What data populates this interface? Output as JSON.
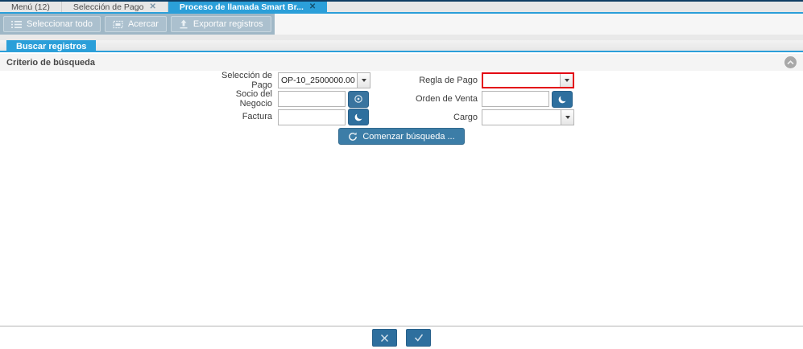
{
  "tabbar": {
    "close_glyph": "✕",
    "tabs": [
      {
        "label": "Menú (12)",
        "closable": false,
        "active": false
      },
      {
        "label": "Selección de Pago",
        "closable": true,
        "active": false
      },
      {
        "label": "Proceso de llamada Smart Br...",
        "closable": true,
        "active": true
      }
    ]
  },
  "toolbar": {
    "buttons": [
      {
        "label": "Seleccionar todo",
        "icon": "select-all-list-icon"
      },
      {
        "label": "Acercar",
        "icon": "zoom-window-icon"
      },
      {
        "label": "Exportar registros",
        "icon": "export-records-icon"
      }
    ]
  },
  "panel": {
    "find_tab": "Buscar registros",
    "section_title": "Criterio de búsqueda"
  },
  "form": {
    "fields": [
      {
        "label": "Selección de Pago",
        "type": "combobox",
        "value": "OP-10_2500000.00"
      },
      {
        "label": "Regla de Pago",
        "type": "combobox",
        "value": "",
        "highlight": "error-red"
      },
      {
        "label": "Socio del Negocio",
        "type": "lookup",
        "value": "",
        "icon": "business-partner-icon"
      },
      {
        "label": "Orden de Venta",
        "type": "lookup",
        "value": "",
        "icon": "record-search-icon"
      },
      {
        "label": "Factura",
        "type": "lookup",
        "value": "",
        "icon": "record-search-icon"
      },
      {
        "label": "Cargo",
        "type": "combobox",
        "value": ""
      }
    ],
    "search_button": "Comenzar búsqueda ..."
  },
  "colors": {
    "accent_blue": "#2b9fd9",
    "button_blue": "#2e6f9e",
    "toolbar_steel": "#9fb7c6",
    "error_red": "#e30613",
    "top_border_navy": "#0e3d63"
  }
}
